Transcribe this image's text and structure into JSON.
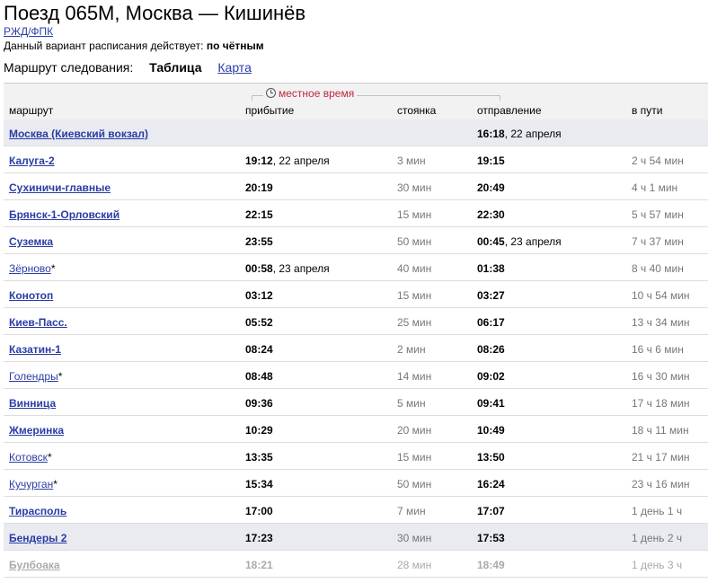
{
  "header": {
    "title": "Поезд 065М, Москва — Кишинёв",
    "carrier": "РЖД/ФПК",
    "validity_label": "Данный вариант расписания действует:",
    "validity_value": "по чётным"
  },
  "view": {
    "label": "Маршрут следования:",
    "active": "Таблица",
    "alt": "Карта"
  },
  "table": {
    "local_time_label": "местное время",
    "columns": {
      "route": "маршрут",
      "arrival": "прибытие",
      "stop": "стоянка",
      "departure": "отправление",
      "travel": "в пути"
    },
    "rows": [
      {
        "station": "Москва (Киевский вокзал)",
        "arr_time": "",
        "arr_date": "",
        "stop": "",
        "dep_time": "16:18",
        "dep_date": ", 22 апреля",
        "travel": ""
      },
      {
        "station": "Калуга-2",
        "arr_time": "19:12",
        "arr_date": ", 22 апреля",
        "stop": "3 мин",
        "dep_time": "19:15",
        "dep_date": "",
        "travel": "2 ч 54 мин"
      },
      {
        "station": "Сухиничи-главные",
        "arr_time": "20:19",
        "arr_date": "",
        "stop": "30 мин",
        "dep_time": "20:49",
        "dep_date": "",
        "travel": "4 ч 1 мин"
      },
      {
        "station": "Брянск-1-Орловский",
        "arr_time": "22:15",
        "arr_date": "",
        "stop": "15 мин",
        "dep_time": "22:30",
        "dep_date": "",
        "travel": "5 ч 57 мин"
      },
      {
        "station": "Суземка",
        "arr_time": "23:55",
        "arr_date": "",
        "stop": "50 мин",
        "dep_time": "00:45",
        "dep_date": ", 23 апреля",
        "travel": "7 ч 37 мин"
      },
      {
        "station": "Зёрново",
        "note": "*",
        "arr_time": "00:58",
        "arr_date": ", 23 апреля",
        "stop": "40 мин",
        "dep_time": "01:38",
        "dep_date": "",
        "travel": "8 ч 40 мин"
      },
      {
        "station": "Конотоп",
        "arr_time": "03:12",
        "arr_date": "",
        "stop": "15 мин",
        "dep_time": "03:27",
        "dep_date": "",
        "travel": "10 ч 54 мин"
      },
      {
        "station": "Киев-Пасс.",
        "arr_time": "05:52",
        "arr_date": "",
        "stop": "25 мин",
        "dep_time": "06:17",
        "dep_date": "",
        "travel": "13 ч 34 мин"
      },
      {
        "station": "Казатин-1",
        "arr_time": "08:24",
        "arr_date": "",
        "stop": "2 мин",
        "dep_time": "08:26",
        "dep_date": "",
        "travel": "16 ч 6 мин"
      },
      {
        "station": "Голендры",
        "note": "*",
        "arr_time": "08:48",
        "arr_date": "",
        "stop": "14 мин",
        "dep_time": "09:02",
        "dep_date": "",
        "travel": "16 ч 30 мин"
      },
      {
        "station": "Винница",
        "arr_time": "09:36",
        "arr_date": "",
        "stop": "5 мин",
        "dep_time": "09:41",
        "dep_date": "",
        "travel": "17 ч 18 мин"
      },
      {
        "station": "Жмеринка",
        "arr_time": "10:29",
        "arr_date": "",
        "stop": "20 мин",
        "dep_time": "10:49",
        "dep_date": "",
        "travel": "18 ч 11 мин"
      },
      {
        "station": "Котовск",
        "note": "*",
        "arr_time": "13:35",
        "arr_date": "",
        "stop": "15 мин",
        "dep_time": "13:50",
        "dep_date": "",
        "travel": "21 ч 17 мин"
      },
      {
        "station": "Кучурган",
        "note": "*",
        "arr_time": "15:34",
        "arr_date": "",
        "stop": "50 мин",
        "dep_time": "16:24",
        "dep_date": "",
        "travel": "23 ч 16 мин"
      },
      {
        "station": "Тирасполь",
        "arr_time": "17:00",
        "arr_date": "",
        "stop": "7 мин",
        "dep_time": "17:07",
        "dep_date": "",
        "travel": "1 день 1 ч"
      },
      {
        "station": "Бендеры 2",
        "arr_time": "17:23",
        "arr_date": "",
        "stop": "30 мин",
        "dep_time": "17:53",
        "dep_date": "",
        "travel": "1 день 2 ч"
      },
      {
        "station": "Булбоака",
        "arr_time": "18:21",
        "arr_date": "",
        "stop": "28 мин",
        "dep_time": "18:49",
        "dep_date": "",
        "travel": "1 день 3 ч"
      }
    ]
  },
  "colors": {
    "link": "#2a3da5",
    "header_bg": "#f2f2f2",
    "highlight_row_bg": "#e9ebf1",
    "local_time_red": "#c2273d"
  }
}
